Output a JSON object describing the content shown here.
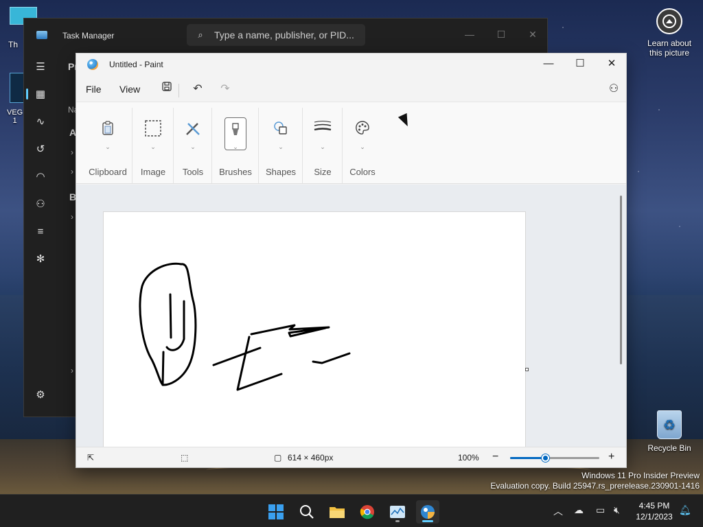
{
  "desktop": {
    "learn_label": "Learn about this picture",
    "recycle_label": "Recycle Bin",
    "left_icon_1_label": "Th",
    "left_icon_2_label_1": "VEG",
    "left_icon_2_label_2": "1"
  },
  "task_manager": {
    "title": "Task Manager",
    "search_placeholder": "Type a name, publisher, or PID...",
    "fragments": {
      "pr": "Pr",
      "na": "Na",
      "a": "A",
      "b": "B"
    },
    "sidebar_icons": [
      "hamburger-icon",
      "processes-icon",
      "performance-icon",
      "app-history-icon",
      "startup-apps-icon",
      "users-icon",
      "details-icon",
      "services-icon",
      "settings-icon"
    ]
  },
  "paint": {
    "title": "Untitled - Paint",
    "menu": {
      "file": "File",
      "view": "View"
    },
    "ribbon_groups": [
      {
        "label": "Clipboard",
        "icon": "clipboard-icon"
      },
      {
        "label": "Image",
        "icon": "selection-icon"
      },
      {
        "label": "Tools",
        "icon": "tools-icon"
      },
      {
        "label": "Brushes",
        "icon": "brush-icon"
      },
      {
        "label": "Shapes",
        "icon": "shapes-icon"
      },
      {
        "label": "Size",
        "icon": "size-icon"
      },
      {
        "label": "Colors",
        "icon": "palette-icon"
      }
    ],
    "status": {
      "canvas_size": "614 × 460px",
      "zoom": "100%",
      "zoom_fraction": 0.4
    }
  },
  "watermark": {
    "line1": "Windows 11 Pro Insider Preview",
    "line2": "Evaluation copy. Build 25947.rs_prerelease.230901-1416"
  },
  "taskbar": {
    "time": "4:45 PM",
    "date": "12/1/2023",
    "accent": "#60cdff"
  }
}
